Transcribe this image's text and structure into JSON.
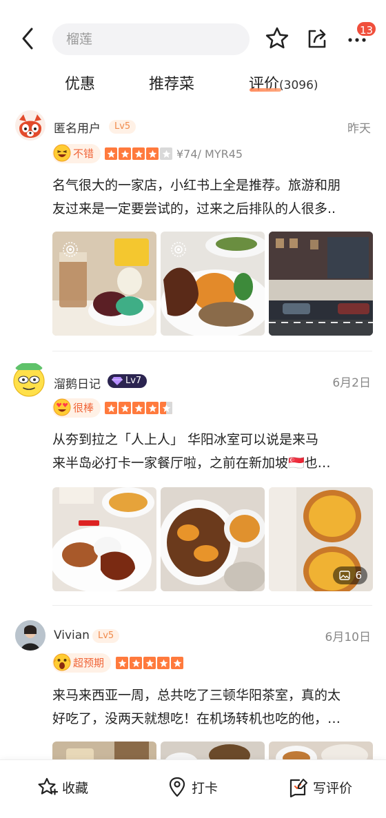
{
  "search": {
    "placeholder": "榴莲"
  },
  "header": {
    "notification_count": "13"
  },
  "tabs": [
    {
      "label": "优惠"
    },
    {
      "label": "推荐菜"
    },
    {
      "label": "评价",
      "count": "(3096)"
    }
  ],
  "reviews": [
    {
      "user": "匿名用户",
      "level": "Lv5",
      "date": "昨天",
      "rating_label": "不错",
      "stars": 4,
      "price": "¥74/ MYR45",
      "text_line1": "名气很大的一家店，小红书上全是推荐。旅游和朋",
      "text_line2": "友过来是一定要尝试的，过来之后排队的人很多.."
    },
    {
      "user": "溜鹅日记",
      "level": "Lv7",
      "date": "6月2日",
      "rating_label": "很棒",
      "stars": 4.5,
      "text_line1": "从夯到拉之「人上人」 华阳冰室可以说是来马",
      "text_line2": "来半岛必打卡一家餐厅啦，之前在新加坡🇸🇬也…",
      "photo_count": "6"
    },
    {
      "user": "Vivian",
      "level": "Lv5",
      "date": "6月10日",
      "rating_label": "超预期",
      "stars": 5,
      "text_line1": "来马来西亚一周，总共吃了三顿华阳茶室，真的太",
      "text_line2": "好吃了，没两天就想吃！在机场转机也吃的他，…"
    }
  ],
  "bottom_bar": {
    "favorite": "收藏",
    "checkin": "打卡",
    "write_review": "写评价"
  },
  "colors": {
    "accent": "#ff7a3d",
    "badge": "#f04f3c",
    "tag_bg": "#fff1e6"
  }
}
